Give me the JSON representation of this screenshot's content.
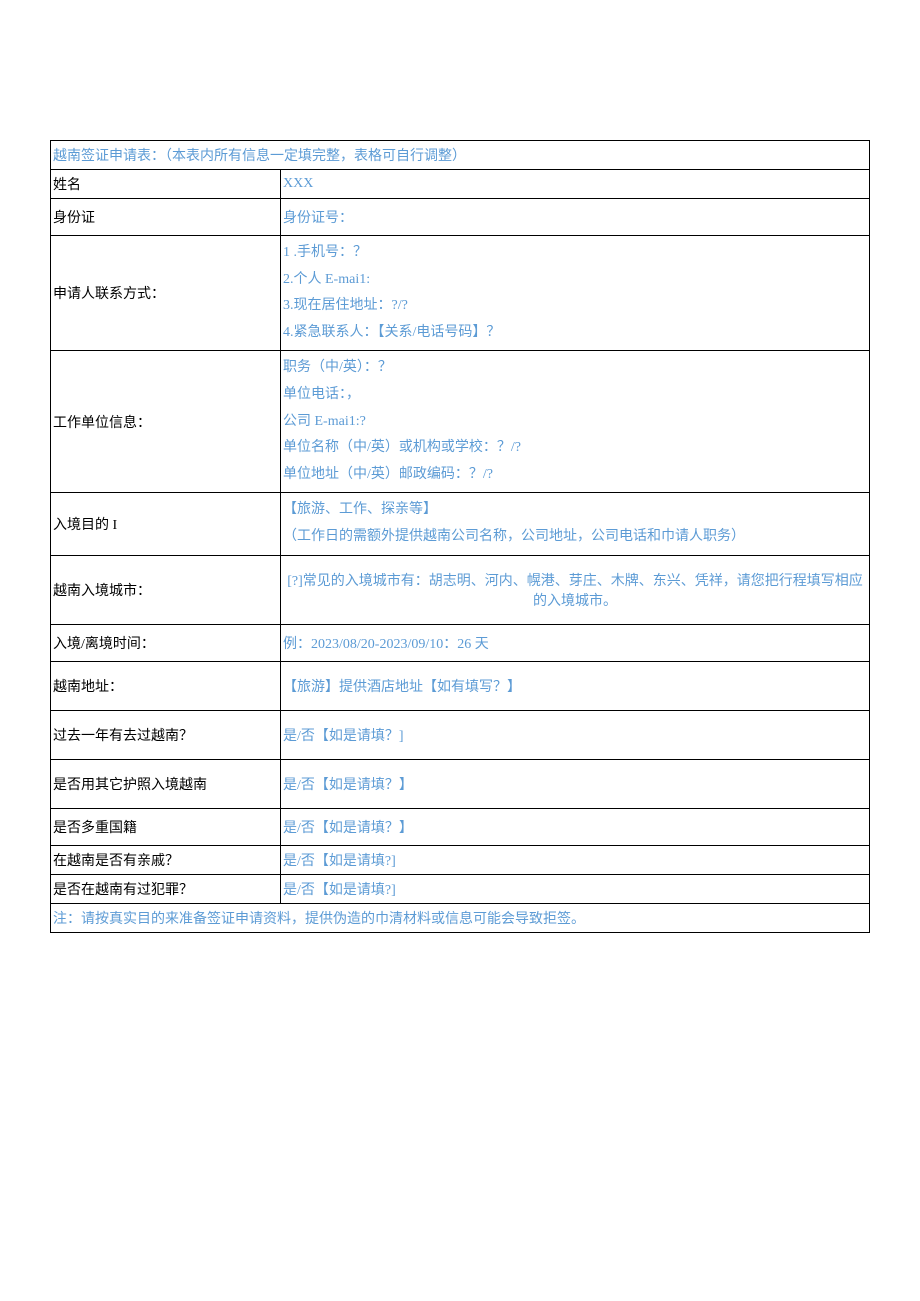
{
  "title": "越南签证申请表：（本表内所有信息一定填完整，表格可自行调整）",
  "rows": {
    "name": {
      "label": "姓名",
      "value": "XXX"
    },
    "id": {
      "label": "身份证",
      "value": "身份证号："
    },
    "contact": {
      "label": "申请人联系方式：",
      "line1": "1        .手机号：？",
      "line2": "2.个人 E-mai1:",
      "line3": "3.现在居住地址：?/?",
      "line4": "4.紧急联系人：【关系/电话号码】？"
    },
    "work": {
      "label": "工作单位信息：",
      "line1": "职务（中/英）：？",
      "line2": "单位电话：，",
      "line3": "公司 E-mai1:?",
      "line4": "单位名称（中/英）或机构或学校：？/?",
      "line5": "单位地址（中/英）邮政编码：？/?"
    },
    "purpose": {
      "label": "入境目的 I",
      "line1": "【旅游、工作、探亲等】",
      "line2": "（工作日的需额外提供越南公司名称，公司地址，公司电话和巾请人职务）"
    },
    "city": {
      "label": "越南入境城市：",
      "value": "[?]常见的入境城市有：胡志明、河内、幌港、芽庄、木牌、东兴、凭祥，请您把行程填写相应的入境城市。"
    },
    "time": {
      "label": "入境/离境时间：",
      "value": "例：2023/08/20-2023/09/10：26 天"
    },
    "address": {
      "label": "越南地址：",
      "value": "【旅游】提供酒店地址【如有填写？】"
    },
    "pastYear": {
      "label": "过去一年有去过越南？",
      "value": "是/否【如是请填？]"
    },
    "otherPassport": {
      "label": "是否用其它护照入境越南",
      "value": "是/否【如是请填？】"
    },
    "multiNationality": {
      "label": "是否多重国籍",
      "value": "是/否【如是请填？】"
    },
    "relatives": {
      "label": "在越南是否有亲戚？",
      "value": "是/否【如是请填?]"
    },
    "crime": {
      "label": "是否在越南有过犯罪？",
      "value": "是/否【如是请填?]"
    }
  },
  "footer": "注：请按真实目的来准备签证申请资料，提供伪造的巾清材料或信息可能会导致拒签。"
}
